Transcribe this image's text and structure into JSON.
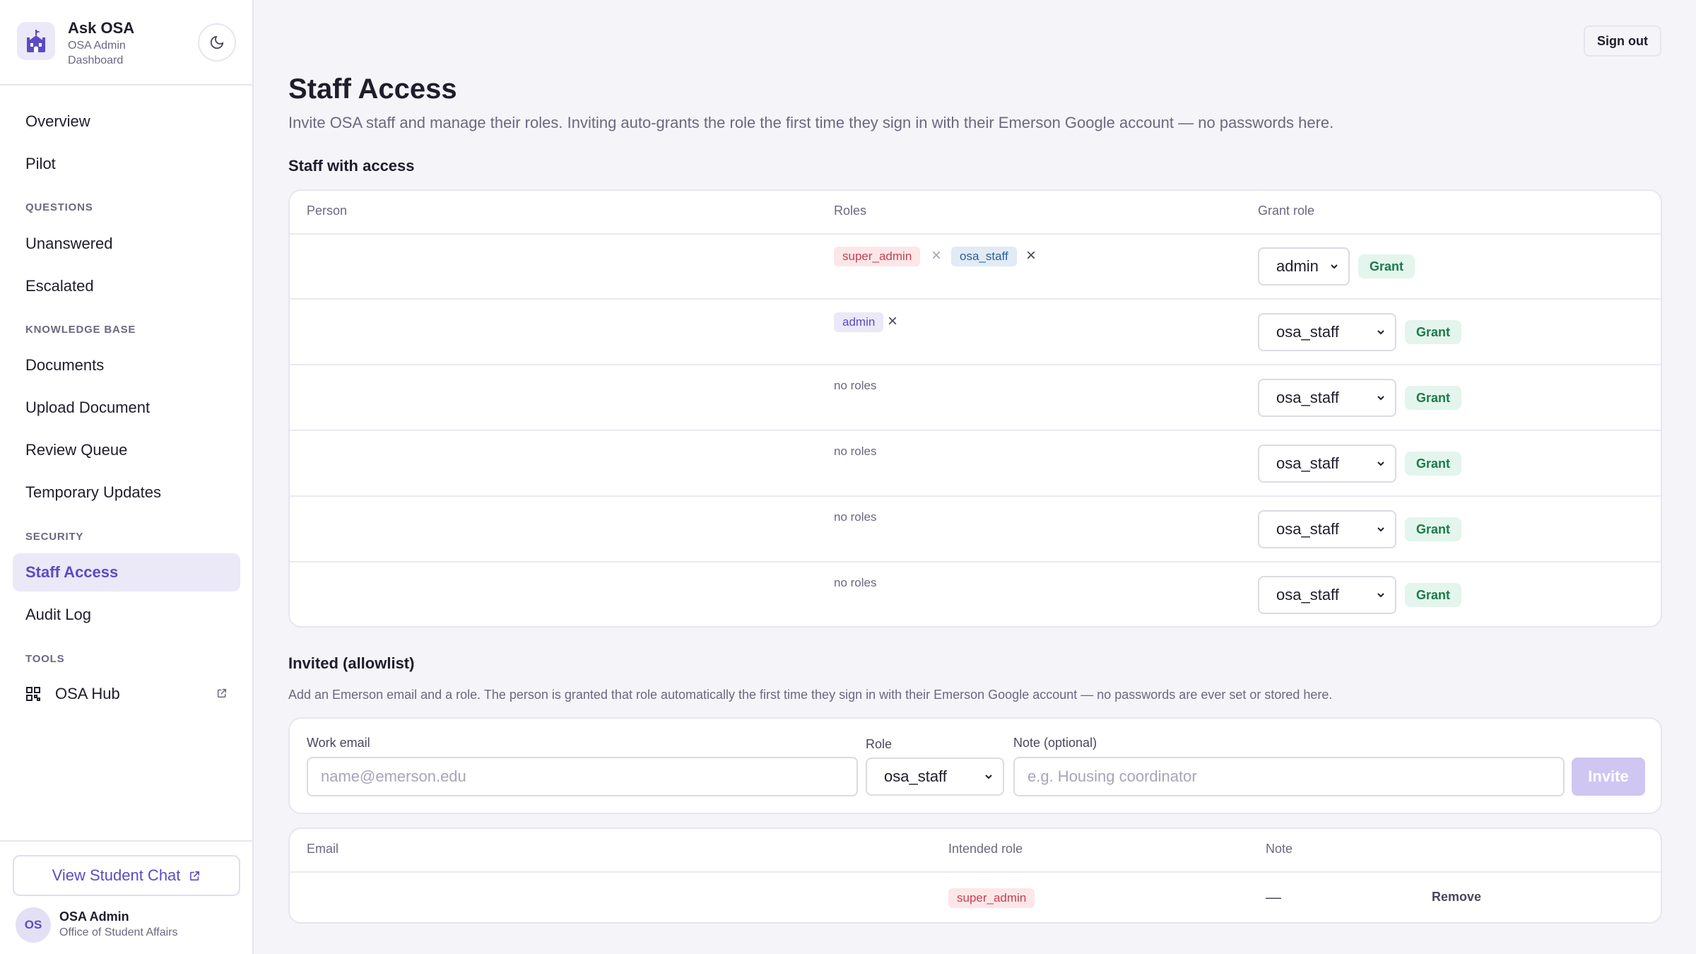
{
  "app": {
    "title": "Ask OSA",
    "subtitle": "OSA Admin Dashboard",
    "logo_icon": "castle-icon",
    "theme_toggle_icon": "moon-icon"
  },
  "sidebar": {
    "items": [
      {
        "label": "Overview"
      },
      {
        "label": "Pilot"
      }
    ],
    "sections": [
      {
        "title": "QUESTIONS",
        "items": [
          {
            "label": "Unanswered"
          },
          {
            "label": "Escalated"
          }
        ]
      },
      {
        "title": "KNOWLEDGE BASE",
        "items": [
          {
            "label": "Documents"
          },
          {
            "label": "Upload Document"
          },
          {
            "label": "Review Queue"
          },
          {
            "label": "Temporary Updates"
          }
        ]
      },
      {
        "title": "SECURITY",
        "items": [
          {
            "label": "Staff Access",
            "active": true
          },
          {
            "label": "Audit Log"
          }
        ]
      },
      {
        "title": "TOOLS",
        "items": [
          {
            "label": "OSA Hub",
            "icon": "grid-icon",
            "external": true
          }
        ]
      }
    ],
    "view_chat": "View Student Chat",
    "user": {
      "initials": "OS",
      "name": "OSA Admin",
      "org": "Office of Student Affairs"
    }
  },
  "header": {
    "sign_out": "Sign out"
  },
  "page": {
    "title": "Staff Access",
    "description": "Invite OSA staff and manage their roles. Inviting auto-grants the role the first time they sign in with their Emerson Google account — no passwords here."
  },
  "staff": {
    "title": "Staff with access",
    "columns": {
      "person": "Person",
      "roles": "Roles",
      "grant": "Grant role"
    },
    "no_roles": "no roles",
    "grant_label": "Grant",
    "rows": [
      {
        "roles": [
          "super_admin",
          "osa_staff"
        ],
        "grant_select": "admin"
      },
      {
        "roles": [
          "admin"
        ],
        "grant_select": "osa_staff"
      },
      {
        "roles": [],
        "grant_select": "osa_staff"
      },
      {
        "roles": [],
        "grant_select": "osa_staff"
      },
      {
        "roles": [],
        "grant_select": "osa_staff"
      },
      {
        "roles": [],
        "grant_select": "osa_staff"
      }
    ]
  },
  "invited": {
    "title": "Invited (allowlist)",
    "description": "Add an Emerson email and a role. The person is granted that role automatically the first time they sign in with their Emerson Google account — no passwords are ever set or stored here.",
    "form": {
      "email_label": "Work email",
      "email_placeholder": "name@emerson.edu",
      "role_label": "Role",
      "role_value": "osa_staff",
      "note_label": "Note (optional)",
      "note_placeholder": "e.g. Housing coordinator",
      "invite_button": "Invite"
    },
    "table": {
      "columns": {
        "email": "Email",
        "role": "Intended role",
        "note": "Note"
      },
      "rows": [
        {
          "email": "",
          "role": "super_admin",
          "note": "—",
          "action": "Remove"
        }
      ]
    }
  },
  "colors": {
    "accent": "#5b4bc4",
    "super_admin_chip": "#fde6e8",
    "osa_staff_chip": "#e0ebf6",
    "admin_chip": "#ebe8f8",
    "grant_button": "#e3f5ec"
  }
}
